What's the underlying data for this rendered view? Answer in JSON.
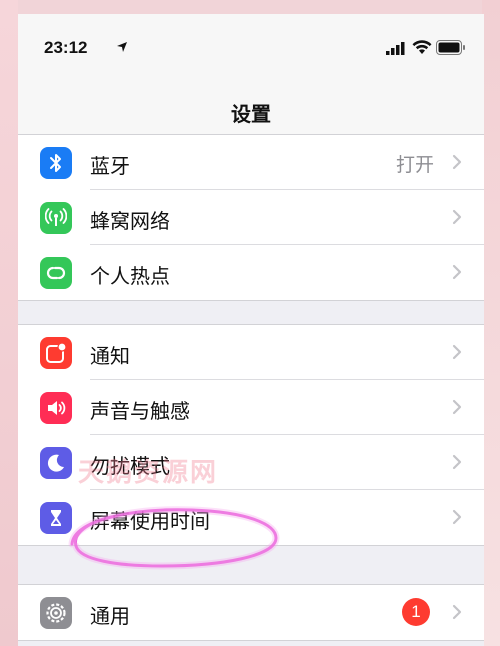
{
  "status_bar": {
    "time": "23:12"
  },
  "nav": {
    "title": "设置"
  },
  "groups": [
    {
      "items": [
        {
          "label": "蓝牙",
          "value": "打开",
          "icon": "bluetooth-icon",
          "color": "#1a7cf5"
        },
        {
          "label": "蜂窝网络",
          "icon": "cellular-antenna-icon",
          "color": "#34c759"
        },
        {
          "label": "个人热点",
          "icon": "personal-hotspot-icon",
          "color": "#34c759"
        }
      ]
    },
    {
      "items": [
        {
          "label": "通知",
          "icon": "notifications-icon",
          "color": "#fe3b30"
        },
        {
          "label": "声音与触感",
          "icon": "speaker-icon",
          "color": "#ff2d55"
        },
        {
          "label": "勿扰模式",
          "icon": "moon-icon",
          "color": "#5e5ce6"
        },
        {
          "label": "屏幕使用时间",
          "icon": "hourglass-icon",
          "color": "#5e5ce6"
        }
      ]
    },
    {
      "items": [
        {
          "label": "通用",
          "badge": "1",
          "icon": "gear-icon",
          "color": "#8e8e93"
        }
      ]
    }
  ],
  "watermark": "天鹅资源网"
}
